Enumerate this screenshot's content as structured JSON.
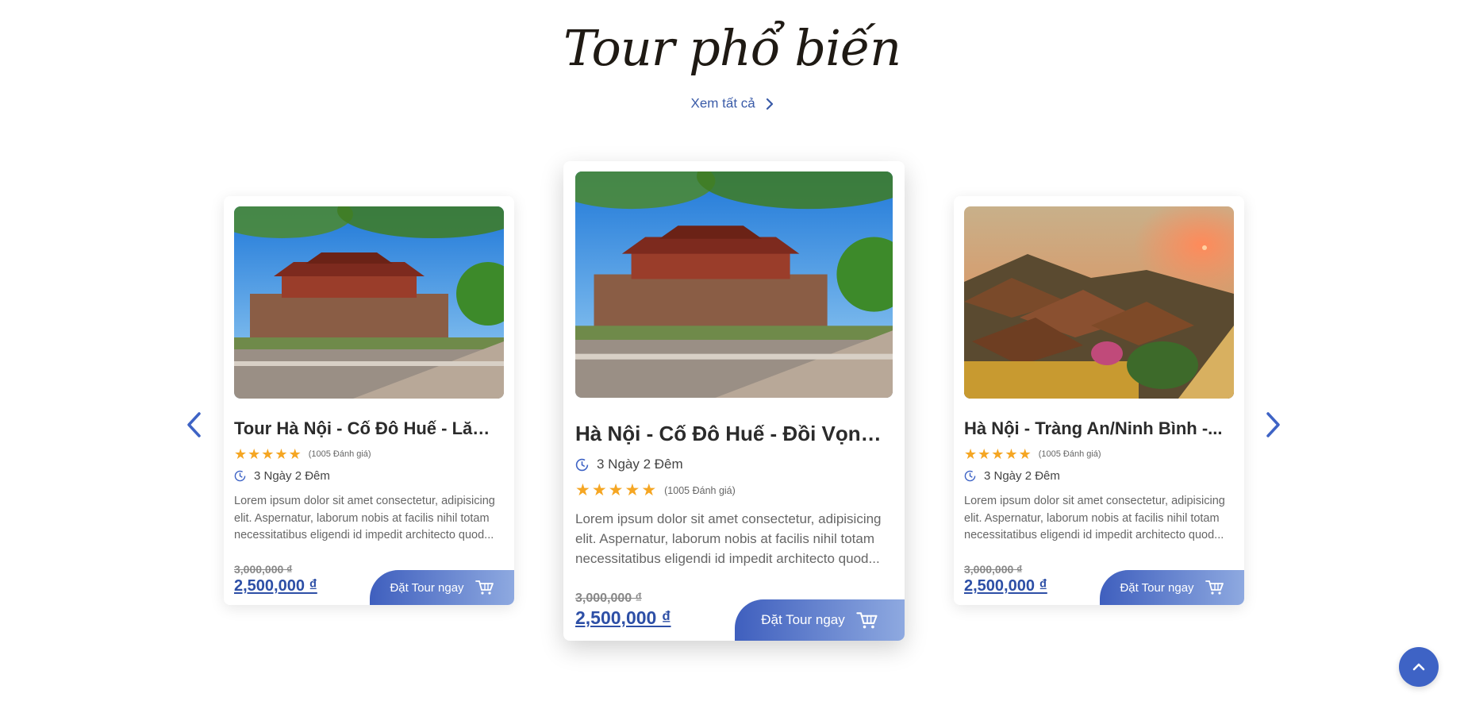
{
  "section": {
    "title": "Tour phổ biến",
    "view_all": "Xem tất cả"
  },
  "colors": {
    "accent": "#3e63c5",
    "price": "#2d4fa6",
    "star": "#f5a623"
  },
  "tours": [
    {
      "title": "Tour Hà Nội - Cố Đô Huế - Lăn...",
      "rating": 5,
      "reviews": "(1005 Đánh giá)",
      "duration": "3 Ngày 2 Đêm",
      "description": "Lorem ipsum dolor sit amet consectetur, adipisicing elit. Aspernatur, laborum nobis at facilis nihil totam necessitatibus eligendi id impedit architecto quod...",
      "old_price": "3,000,000 ₫",
      "new_price": "2,500,000 ₫",
      "button": "Đặt Tour ngay",
      "image": "hue-imperial-gate"
    },
    {
      "title": "Hà Nội - Cố Đô Huế - Đồi Vọng...",
      "rating": 5,
      "reviews": "(1005 Đánh giá)",
      "duration": "3 Ngày 2 Đêm",
      "description": "Lorem ipsum dolor sit amet consectetur, adipisicing elit. Aspernatur, laborum nobis at facilis nihil totam necessitatibus eligendi id impedit architecto quod...",
      "old_price": "3,000,000 ₫",
      "new_price": "2,500,000 ₫",
      "button": "Đặt Tour ngay",
      "image": "hue-imperial-gate"
    },
    {
      "title": "Hà Nội - Tràng An/Ninh Bình -...",
      "rating": 5,
      "reviews": "(1005 Đánh giá)",
      "duration": "3 Ngày 2 Đêm",
      "description": "Lorem ipsum dolor sit amet consectetur, adipisicing elit. Aspernatur, laborum nobis at facilis nihil totam necessitatibus eligendi id impedit architecto quod...",
      "old_price": "3,000,000 ₫",
      "new_price": "2,500,000 ₫",
      "button": "Đặt Tour ngay",
      "image": "hoi-an-rooftops"
    }
  ],
  "icons": {
    "prev": "chevron-left-icon",
    "next": "chevron-right-icon",
    "back_to_top": "chevron-up-icon",
    "cart": "cart-icon",
    "clock": "clock-icon"
  }
}
